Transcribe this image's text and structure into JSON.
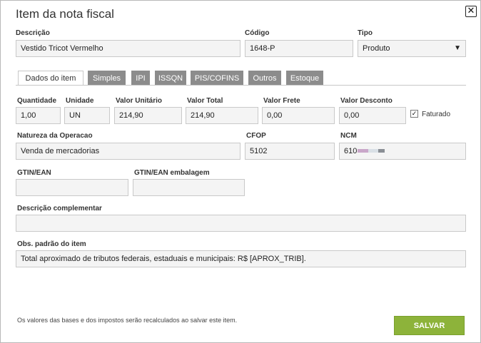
{
  "dialog": {
    "title": "Item da nota fiscal",
    "close_symbol": "✕",
    "labels": {
      "descricao": "Descrição",
      "codigo": "Código",
      "tipo": "Tipo",
      "quantidade": "Quantidade",
      "unidade": "Unidade",
      "valor_unitario": "Valor Unitário",
      "valor_total": "Valor Total",
      "valor_frete": "Valor Frete",
      "valor_desconto": "Valor Desconto",
      "natureza": "Natureza da Operacao",
      "cfop": "CFOP",
      "ncm": "NCM",
      "gtin": "GTIN/EAN",
      "gtin_embalagem": "GTIN/EAN embalagem",
      "descricao_complementar": "Descrição complementar",
      "obs_padrao": "Obs. padrão do item"
    },
    "values": {
      "descricao": "Vestido Tricot Vermelho",
      "codigo": "1648-P",
      "tipo": "Produto",
      "quantidade": "1,00",
      "unidade": "UN",
      "valor_unitario": "214,90",
      "valor_total": "214,90",
      "valor_frete": "0,00",
      "valor_desconto": "0,00",
      "natureza": "Venda de mercadorias",
      "cfop": "5102",
      "ncm": "610",
      "gtin": "",
      "gtin_embalagem": "",
      "descricao_complementar": "",
      "obs_padrao": "Total aproximado de tributos federais, estaduais e municipais: R$ [APROX_TRIB]."
    },
    "faturado": {
      "label": "Faturado",
      "checked": true,
      "mark": "✓"
    },
    "tabs": [
      {
        "label": "Dados do item",
        "active": true
      },
      {
        "label": "Simples",
        "active": false
      },
      {
        "label": "IPI",
        "active": false
      },
      {
        "label": "ISSQN",
        "active": false
      },
      {
        "label": "PIS/COFINS",
        "active": false
      },
      {
        "label": "Outros",
        "active": false
      },
      {
        "label": "Estoque",
        "active": false
      }
    ],
    "footer_note": "Os valores das bases e dos impostos serão recalculados ao salvar este item.",
    "save_label": "SALVAR",
    "select_arrow": "▼"
  },
  "colors": {
    "accent_save": "#8db33a",
    "tab_inactive": "#8c8c8c",
    "field_bg": "#f4f4f4"
  }
}
